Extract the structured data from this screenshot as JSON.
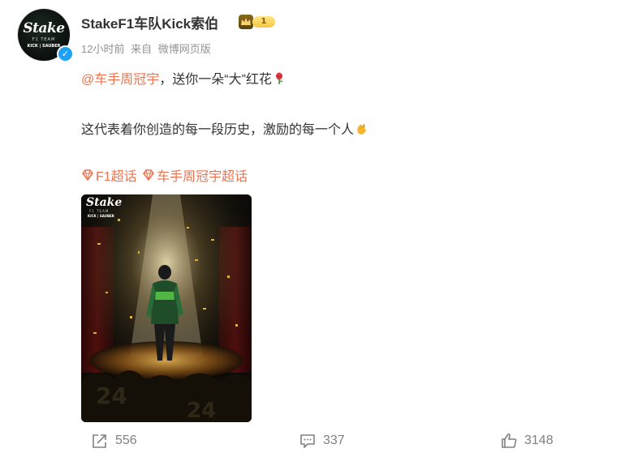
{
  "post": {
    "author": {
      "name": "StakeF1车队Kick索伯",
      "level": "1",
      "avatar_brand": "Stake",
      "avatar_team": "F1 TEAM",
      "avatar_sponsor": "KICK | SAUBER",
      "verified": true
    },
    "meta": {
      "time": "12小时前",
      "source_prefix": "来自",
      "source": "微博网页版"
    },
    "text": {
      "mention": "@车手周冠宇",
      "line1_rest": "，送你一朵“大”红花",
      "rose_icon": "rose-icon",
      "line2": "这代表着你创造的每一段历史，激励的每一个人",
      "clap_icon": "clapping-hands-icon"
    },
    "topics": [
      {
        "label": "F1超话",
        "icon": "diamond-icon"
      },
      {
        "label": "车手周冠宇超话",
        "icon": "diamond-icon"
      }
    ],
    "image": {
      "brand": "Stake",
      "team": "F1 TEAM",
      "sponsor": "KICK | SAUBER"
    },
    "actions": {
      "share_count": "556",
      "comment_count": "337",
      "like_count": "3148"
    }
  },
  "colors": {
    "link": "#eb7350",
    "meta": "#939393",
    "text": "#333333",
    "action": "#808080",
    "verify": "#1da1f2"
  }
}
